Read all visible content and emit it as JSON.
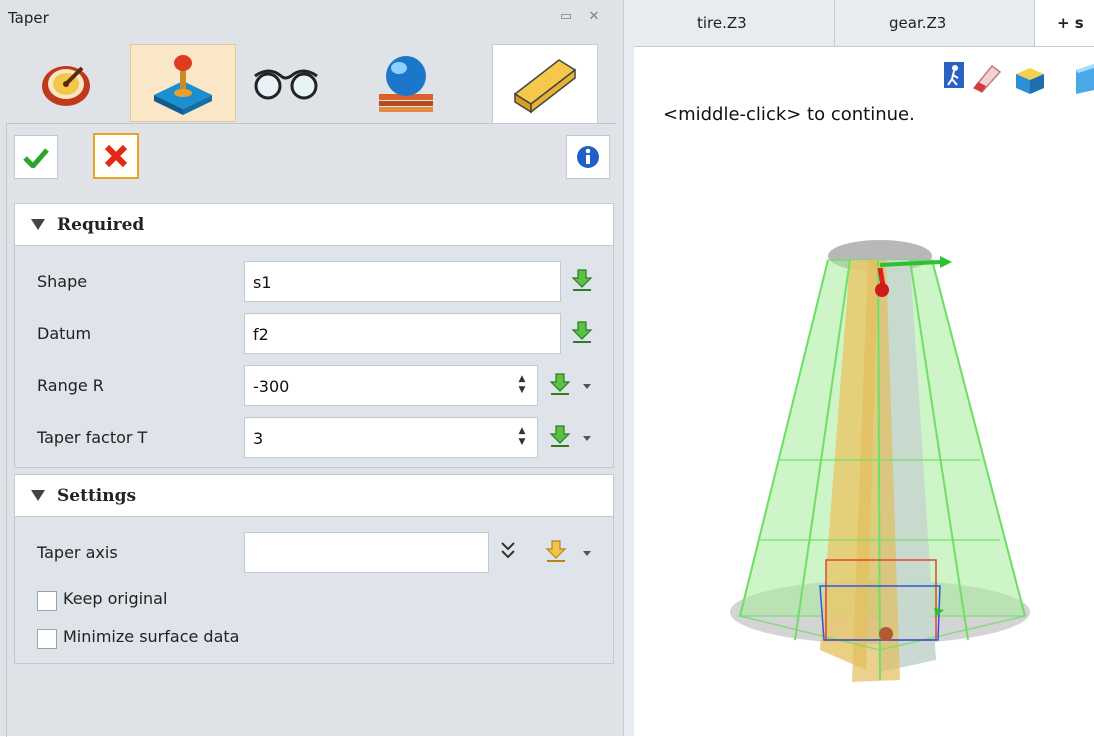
{
  "panel": {
    "title": "Taper",
    "tool_tabs": [
      {
        "name": "clock-icon"
      },
      {
        "name": "joystick-icon",
        "selected": true
      },
      {
        "name": "glasses-icon"
      },
      {
        "name": "sphere-icon"
      },
      {
        "name": "bar-icon",
        "active": true
      }
    ],
    "ok_icon": "checkmark-icon",
    "cancel_icon": "x-icon",
    "info_icon": "info-icon"
  },
  "required": {
    "title": "Required",
    "rows": [
      {
        "label": "Shape",
        "value": "s1"
      },
      {
        "label": "Datum",
        "value": "f2"
      },
      {
        "label": "Range R",
        "value": "-300"
      },
      {
        "label": "Taper factor T",
        "value": "3"
      }
    ]
  },
  "settings": {
    "title": "Settings",
    "taper_axis_label": "Taper axis",
    "taper_axis_value": "",
    "keep_original": "Keep original",
    "keep_original_checked": false,
    "minimize_surface": "Minimize surface data",
    "minimize_surface_checked": false
  },
  "viewer": {
    "tabs": [
      "tire.Z3",
      "gear.Z3",
      "+ s"
    ],
    "status": "<middle-click> to continue."
  },
  "colors": {
    "accent": "#f5c96d",
    "model_green": "#7ee17e",
    "model_core": "#e8c26a"
  }
}
